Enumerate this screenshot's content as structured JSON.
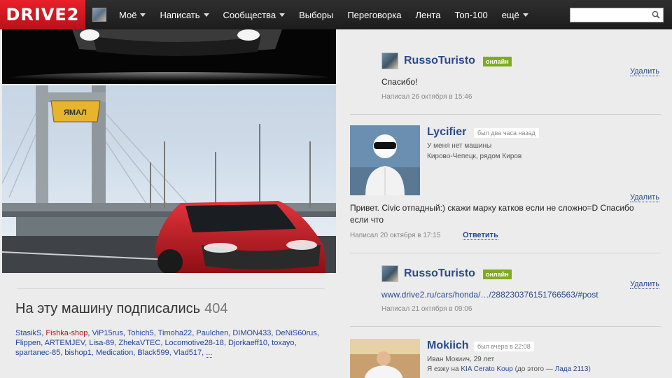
{
  "header": {
    "logo": "DRIVE2",
    "nav": [
      {
        "label": "Моё",
        "dropdown": true
      },
      {
        "label": "Написать",
        "dropdown": true
      },
      {
        "label": "Сообщества",
        "dropdown": true
      },
      {
        "label": "Выборы",
        "dropdown": false
      },
      {
        "label": "Переговорка",
        "dropdown": false
      },
      {
        "label": "Лента",
        "dropdown": false
      },
      {
        "label": "Топ-100",
        "dropdown": false
      },
      {
        "label": "ещё",
        "dropdown": true
      }
    ],
    "search_placeholder": ""
  },
  "photos": {
    "bridge_sign": "ЯМАЛ"
  },
  "subscribers": {
    "title": "На эту машину подписались",
    "count": "404",
    "names": [
      "StasikS",
      "Fishka-shop",
      "ViP15rus",
      "Tohich5",
      "Timoha22",
      "Paulchen",
      "DIMON433",
      "DeNiS60rus",
      "Flippen",
      "ARTEMJEV",
      "Lisa-89",
      "ZhekaVTEC",
      "Locomotive28-18",
      "Djorkaeff10",
      "toxayo",
      "spartanec-85",
      "bishop1",
      "Medication",
      "Black599",
      "Vlad517"
    ],
    "highlight": "Fishka-shop",
    "more": "..."
  },
  "comments": {
    "c1": {
      "user": "RussoTuristo",
      "status": "онлайн",
      "delete": "Удалить",
      "text": "Спасибо!",
      "meta": "Написал 26 октября в 15:46"
    },
    "c2": {
      "user": "Lycifier",
      "seen": "был два часа назад",
      "car": "У меня нет машины",
      "location": "Кирово-Чепецк, рядом Киров",
      "delete": "Удалить",
      "text": "Привет. Civic отпадный:) скажи марку катков если не сложно=D Спасибо если что",
      "meta": "Написал 20 октября в 17:15",
      "reply": "Ответить"
    },
    "c3": {
      "user": "RussoTuristo",
      "status": "онлайн",
      "delete": "Удалить",
      "text": "www.drive2.ru/cars/honda/…/288230376151766563/#post",
      "meta": "Написал 21 октября в 09:06"
    },
    "c4": {
      "user": "Mokiich",
      "seen": "был вчера в 22:08",
      "info": "Иван Мокиич, 29 лет",
      "drive_prefix": "Я езжу на",
      "car": "KIA Cerato Koup",
      "before": "(до этого —",
      "prev_car": "Лада 2113",
      "after": ")"
    }
  }
}
